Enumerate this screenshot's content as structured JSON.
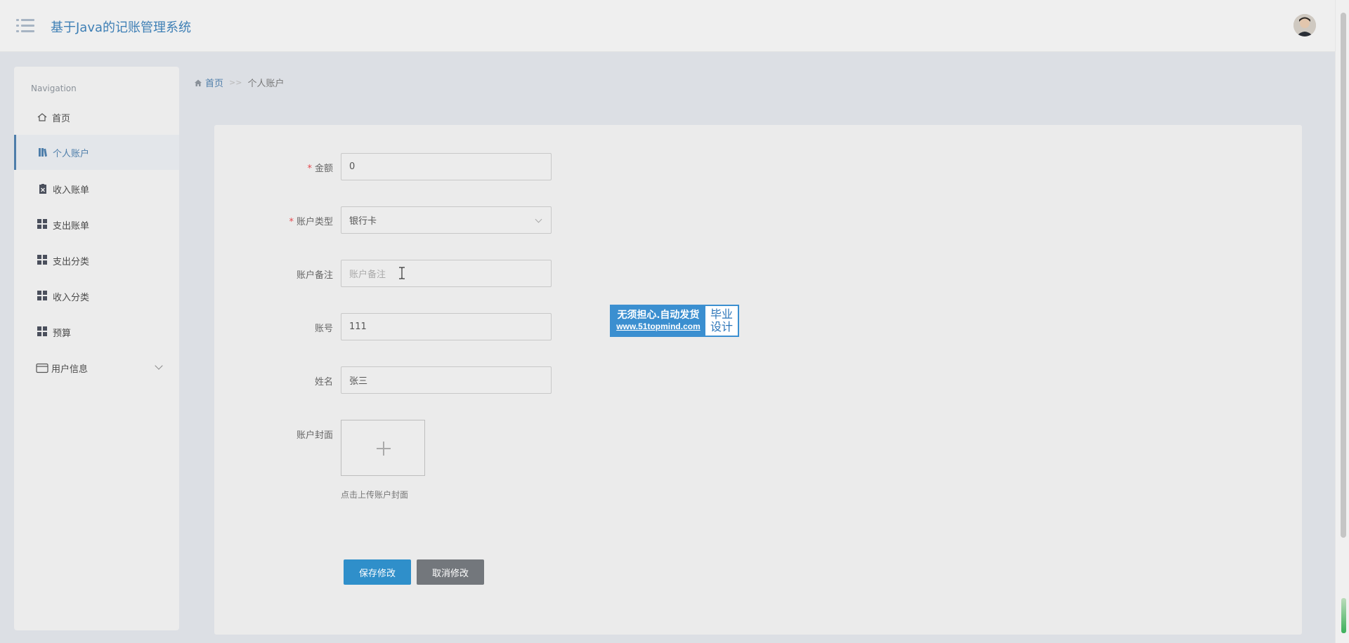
{
  "header": {
    "title": "基于Java的记账管理系统",
    "menu_icon": "hamburger-menu-icon",
    "avatar_icon": "user-avatar"
  },
  "sidebar": {
    "heading": "Navigation",
    "items": [
      {
        "label": "首页",
        "icon": "home-icon",
        "active": false
      },
      {
        "label": "个人账户",
        "icon": "book-icon",
        "active": true
      },
      {
        "label": "收入账单",
        "icon": "clipboard-icon",
        "active": false
      },
      {
        "label": "支出账单",
        "icon": "grid-icon",
        "active": false
      },
      {
        "label": "支出分类",
        "icon": "grid-icon",
        "active": false
      },
      {
        "label": "收入分类",
        "icon": "grid-icon",
        "active": false
      },
      {
        "label": "预算",
        "icon": "grid-icon",
        "active": false
      },
      {
        "label": "用户信息",
        "icon": "wallet-icon",
        "active": false,
        "has_submenu": true
      }
    ]
  },
  "breadcrumb": {
    "home": "首页",
    "separator": ">>",
    "current": "个人账户"
  },
  "form": {
    "amount": {
      "label": "金额",
      "required": true,
      "value": "0"
    },
    "account_type": {
      "label": "账户类型",
      "required": true,
      "value": "银行卡"
    },
    "remark": {
      "label": "账户备注",
      "required": false,
      "value": "",
      "placeholder": "账户备注"
    },
    "account_number": {
      "label": "账号",
      "required": false,
      "value": "111"
    },
    "name": {
      "label": "姓名",
      "required": false,
      "value": "张三"
    },
    "cover": {
      "label": "账户封面",
      "hint": "点击上传账户封面"
    },
    "required_mark": "*"
  },
  "buttons": {
    "save": "保存修改",
    "cancel": "取消修改"
  },
  "watermark": {
    "line1": "无须担心.自动发货",
    "line2": "www.51topmind.com",
    "right1": "毕业",
    "right2": "设计"
  },
  "colors": {
    "accent": "#4e7eaa",
    "primary_button": "#2f8fca",
    "secondary_button": "#73777c",
    "required": "#e5484d"
  }
}
